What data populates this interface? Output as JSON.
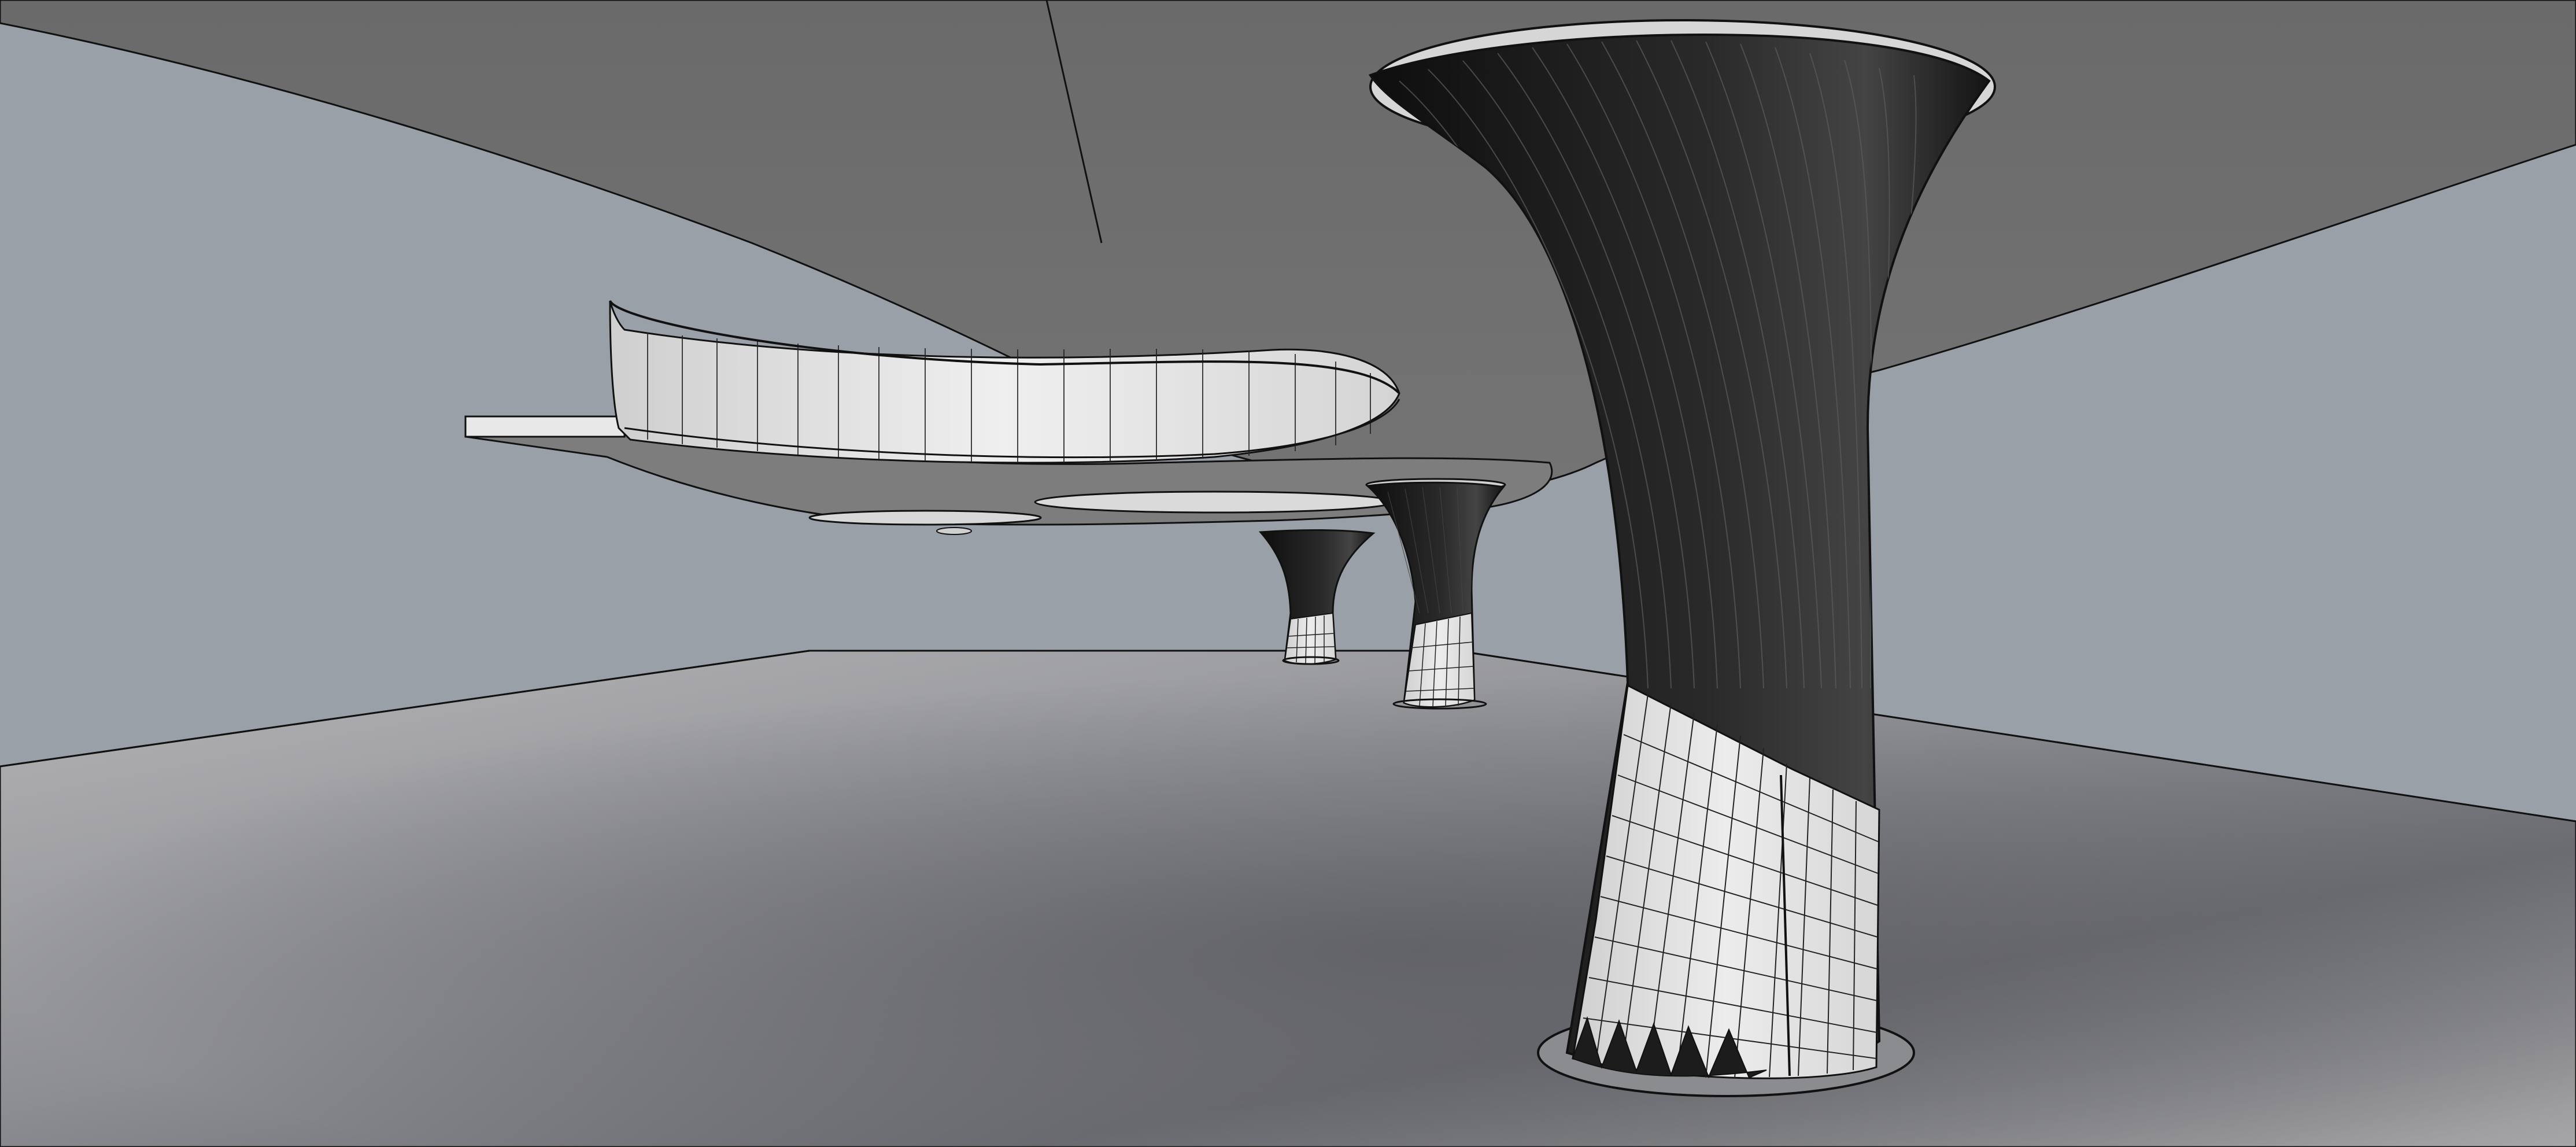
{
  "viewport": {
    "render_mode": "shaded-wireframe",
    "colors": {
      "sky_wall": "#9aa0a8",
      "ceiling": "#6e6e6e",
      "ceiling_light": "#7a7a7a",
      "floor_light": "#a8a8aa",
      "floor_dark": "#6a6b70",
      "column_dark": "#1a1a1a",
      "cladding": "#e2e2e2",
      "edge": "#111111"
    }
  },
  "scene": {
    "objects": [
      {
        "name": "ceiling-slab",
        "kind": "surface"
      },
      {
        "name": "floor-plane",
        "kind": "surface"
      },
      {
        "name": "left-wall",
        "kind": "surface"
      },
      {
        "name": "right-wall",
        "kind": "surface"
      },
      {
        "name": "upper-balcony",
        "kind": "curved-glass-railing"
      },
      {
        "name": "column-near",
        "kind": "flared-column",
        "cladding": "tiled-base"
      },
      {
        "name": "column-mid",
        "kind": "flared-column",
        "cladding": "tiled-base"
      },
      {
        "name": "column-far",
        "kind": "flared-column",
        "cladding": "tiled-base"
      }
    ]
  }
}
